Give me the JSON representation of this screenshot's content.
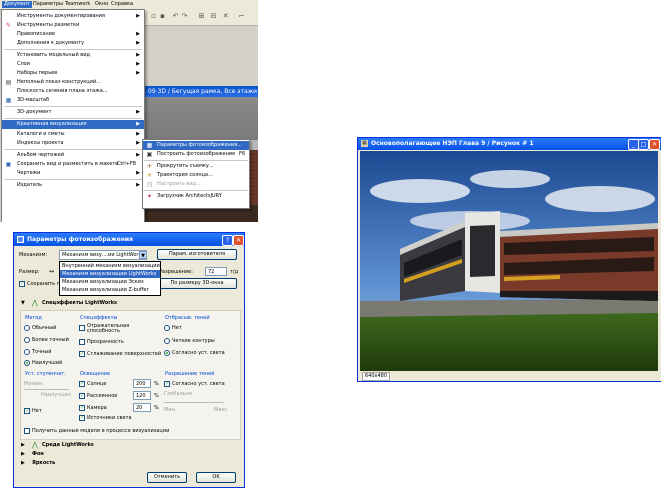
{
  "menubar": {
    "items": [
      "Документ",
      "Параметры",
      "Teamwork",
      "Окно",
      "Справка"
    ]
  },
  "background": {
    "window_title": "09 3D / Бегущая рамка, Все этажи"
  },
  "doc_menu": {
    "items": [
      {
        "label": "Инструменты документирования",
        "arrow": "▶"
      },
      {
        "label": "Инструменты разметки",
        "arrow": ""
      },
      {
        "label": "Правописание",
        "arrow": "▶"
      },
      {
        "label": "Дополнения к документу",
        "arrow": "▶"
      },
      {
        "label": "Установить модельный вид",
        "arrow": "▶"
      },
      {
        "label": "Слои",
        "arrow": "▶"
      },
      {
        "label": "Наборы перьев",
        "arrow": "▶"
      },
      {
        "label": "Неполный показ конструкций...",
        "arrow": ""
      },
      {
        "label": "Плоскость сечения плана этажа...",
        "arrow": ""
      },
      {
        "label": "3D-масштаб",
        "arrow": ""
      },
      {
        "label": "3D-документ",
        "arrow": "▶"
      },
      {
        "label": "Креативная визуализация",
        "arrow": "▶"
      },
      {
        "label": "Каталоги и сметы",
        "arrow": "▶"
      },
      {
        "label": "Индексы проекта",
        "arrow": "▶"
      },
      {
        "label": "Альбом чертежей",
        "arrow": "▶"
      },
      {
        "label": "Сохранить вид и разместить в макете",
        "arrow": "",
        "shortcut": "Ctrl+F8"
      },
      {
        "label": "Чертежи",
        "arrow": "▶"
      },
      {
        "label": "Издатель",
        "arrow": "▶"
      }
    ]
  },
  "submenu": {
    "items": [
      {
        "label": "Параметры фотоизображения...",
        "shortcut": ""
      },
      {
        "label": "Построить фотоизображение",
        "shortcut": "F6"
      },
      {
        "label": "Прокрутить съемку...",
        "shortcut": ""
      },
      {
        "label": "Траектория солнца...",
        "shortcut": ""
      },
      {
        "label": "Настроить вид...",
        "shortcut": ""
      },
      {
        "label": "Загрузчик ArchitectsJURY",
        "shortcut": ""
      }
    ]
  },
  "dialog": {
    "title": "Параметры фотоизображения",
    "help": "?",
    "close": "✕",
    "engine_label": "Механизм:",
    "engine_value": "Механизм визу....ии LightWorks",
    "engine_options": [
      "Внутренний механизм визуализации",
      "Механизм визуализации LightWorks",
      "Механизм визуализации Эскиз",
      "Механизм визуализации Z-buffer"
    ],
    "size_label": "Размер:",
    "save_label": "Сохранить п",
    "resolution_label": "Разрешение:",
    "resolution_value": "72",
    "resolution_unit": "т/д",
    "params_button": "Парам. изготовителя",
    "fit_3d_button": "По размеру 3D-окна",
    "effects_header": "Спецэффекты LightWorks",
    "method": {
      "title": "Метод",
      "options": [
        "Обычный",
        "Более точный",
        "Точный",
        "Наилучший"
      ]
    },
    "special_effects": {
      "title": "Спецэффекты",
      "options": [
        "Отражательная способность",
        "Прозрачность",
        "Сглаживание поверхностей"
      ]
    },
    "shadows": {
      "title": "Отбрасыв. теней",
      "options": [
        "Нет",
        "Четкие контуры",
        "Согласно уст. света"
      ]
    },
    "antialias": {
      "title": "Уст. ступенчат.",
      "min": "Миним.",
      "max": "Наилучшая",
      "none": "Нет"
    },
    "lighting": {
      "title": "Освещение",
      "items": [
        {
          "label": "Солнце",
          "value": "200",
          "unit": "%"
        },
        {
          "label": "Рассеянное",
          "value": "120",
          "unit": "%"
        },
        {
          "label": "Камера",
          "value": "20",
          "unit": "%"
        },
        {
          "label": "Источники света",
          "value": "",
          "unit": ""
        }
      ]
    },
    "shadow_res": {
      "title": "Разрешение теней",
      "option": "Согласно уст. света",
      "sub": "Глобально",
      "min": "Мин.",
      "max": "Макс."
    },
    "obtain_data": "Получить данные модели в процессе визуализации",
    "env_header": "Среда LightWorks",
    "bg_header": "Фон",
    "brightness_header": "Яркость",
    "cancel_button": "Отменить",
    "ok_button": "OK"
  },
  "render_window": {
    "title": "Основополагающее НЭП Глава 9 / Рисунок # 1",
    "status": "640x480"
  },
  "colors": {
    "xp_blue": "#0551e5",
    "highlight": "#316ac5",
    "accent_green": "#21a121"
  }
}
